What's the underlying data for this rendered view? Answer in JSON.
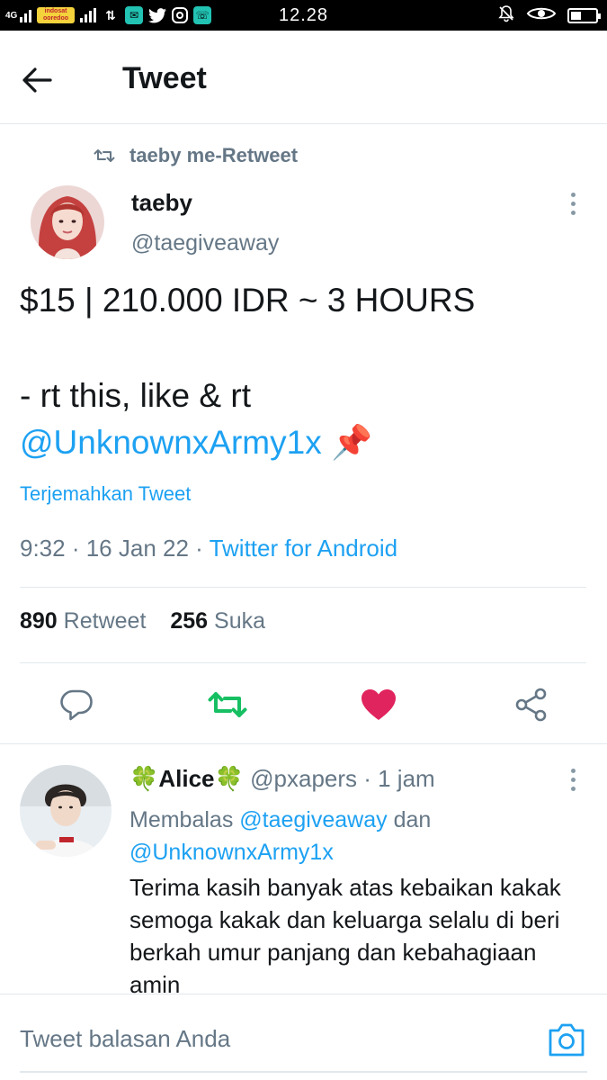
{
  "status_bar": {
    "network": "4G",
    "carrier_logo": "indosat ooredoo",
    "time": "12.28"
  },
  "header": {
    "title": "Tweet"
  },
  "retweet_context": {
    "label": "taeby me-Retweet"
  },
  "tweet": {
    "author_name": "taeby",
    "author_handle": "@taegiveaway",
    "text_line1": "$15 | 210.000 IDR ~ 3 HOURS",
    "text_line2": "- rt this, like & rt",
    "mention": "@UnknownxArmy1x",
    "emoji": "📌",
    "translate_label": "Terjemahkan Tweet",
    "timestamp": "9:32 · 16 Jan 22 · ",
    "source": "Twitter for Android",
    "retweet_count": "890",
    "retweet_label": "Retweet",
    "like_count": "256",
    "like_label": "Suka"
  },
  "reply": {
    "name": "🍀Alice🍀",
    "handle_time": "@pxapers · 1 jam",
    "replying_prefix": "Membalas ",
    "replying_user1": "@taegiveaway",
    "replying_and": " dan",
    "replying_user2": "@UnknownxArmy1x",
    "text": "Terima kasih banyak atas kebaikan kakak semoga kakak dan keluarga selalu di beri berkah umur panjang dan kebahagiaan amin"
  },
  "composer": {
    "placeholder": "Tweet balasan Anda"
  },
  "colors": {
    "accent": "#1da1f2",
    "retweet_green": "#17bf63",
    "like_pink": "#e0245e",
    "secondary_text": "#657786"
  },
  "icons": {
    "back": "arrow-left-icon",
    "retweet_context": "retweet-icon",
    "more": "more-vertical-icon",
    "reply": "reply-icon",
    "retweet": "retweet-icon",
    "like": "heart-icon",
    "share": "share-icon",
    "camera": "camera-icon"
  }
}
